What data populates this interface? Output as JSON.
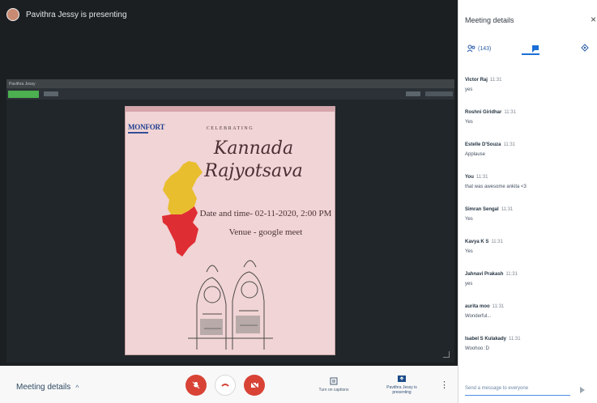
{
  "presenter": {
    "label": "Pavithra Jessy is presenting"
  },
  "shared_window": {
    "title": "Pavithra Jessy",
    "toolbar": [
      "",
      "",
      ""
    ]
  },
  "poster": {
    "logo": "MONFORT",
    "celebrating": "CELEBRATING",
    "title_line1": "Kannada",
    "title_line2": "Rajyotsava",
    "datetime": "Date and time- 02-11-2020, 2:00 PM",
    "venue": "Venue - google meet"
  },
  "sidebar": {
    "title": "Meeting details",
    "close": "×",
    "tabs": [
      {
        "name": "people",
        "label": "(143)"
      },
      {
        "name": "chat",
        "label": ""
      },
      {
        "name": "activities",
        "label": ""
      }
    ],
    "messages": [
      {
        "author": "Victor Raj",
        "time": "11:31",
        "text": "yes"
      },
      {
        "author": "Roshni Giridhar",
        "time": "11:31",
        "text": "Yes"
      },
      {
        "author": "Estelle D'Souza",
        "time": "11:31",
        "text": "Applause"
      },
      {
        "author": "You",
        "time": "11:31",
        "text": "that was awesome ankita <3"
      },
      {
        "author": "Simran Sengal",
        "time": "11:31",
        "text": "Yes"
      },
      {
        "author": "Kavya K S",
        "time": "11:31",
        "text": "Yes"
      },
      {
        "author": "Jahnavi Prakash",
        "time": "11:31",
        "text": "yes"
      },
      {
        "author": "aurita moo",
        "time": "11:31",
        "text": "Wonderful..."
      },
      {
        "author": "Isabel S Kulakady",
        "time": "11:31",
        "text": "Woohoo :D"
      }
    ],
    "input_placeholder": "Send a message to everyone"
  },
  "bottom_bar": {
    "meeting_details": "Meeting details",
    "captions": "Turn on captions",
    "presenting": "Pavithra Jessy is presenting"
  },
  "colors": {
    "accent": "#1b6fd6",
    "danger": "#d84336",
    "stage_bg": "#1b1f22",
    "poster_bg": "#f1d4d5"
  }
}
